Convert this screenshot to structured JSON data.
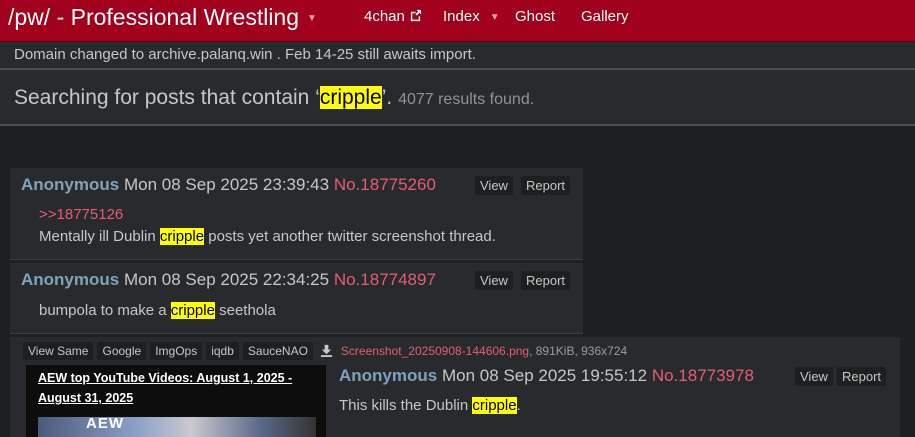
{
  "navbar": {
    "brand": "/pw/ - Professional Wrestling",
    "items": [
      "4chan",
      "Index",
      "Ghost",
      "Gallery"
    ]
  },
  "notice": "Domain changed to archive.palanq.win . Feb 14-25 still awaits import.",
  "search": {
    "prefix": "Searching for posts that contain ‘",
    "term": "cripple",
    "suffix": "’.",
    "results": "4077 results found."
  },
  "posts": [
    {
      "name": "Anonymous",
      "date": "Mon 08 Sep 2025 23:39:43",
      "number": "No.18775260",
      "view": "View",
      "report": "Report",
      "quote": ">>18775126",
      "text_before": "Mentally ill Dublin ",
      "highlight": "cripple",
      "text_after": " posts yet another twitter screenshot thread."
    },
    {
      "name": "Anonymous",
      "date": "Mon 08 Sep 2025 22:34:25",
      "number": "No.18774897",
      "view": "View",
      "report": "Report",
      "text_before": "bumpola to make a ",
      "highlight": "cripple",
      "text_after": " seethola"
    },
    {
      "name": "Anonymous",
      "date": "Mon 08 Sep 2025 19:55:12",
      "number": "No.18773978",
      "view": "View",
      "report": "Report",
      "text_before": "This kills the Dublin ",
      "highlight": "cripple",
      "text_after": ".",
      "file_tools": [
        "View Same",
        "Google",
        "ImgOps",
        "iqdb",
        "SauceNAO"
      ],
      "file_name": "Screenshot_20250908-144606.png",
      "file_meta": ", 891KiB, 936x724",
      "thumb_title": "AEW top YouTube Videos: August 1, 2025 - August 31, 2025",
      "thumb_logo": "AEW"
    }
  ],
  "colors": {
    "navbar": "#a0001c",
    "background": "#1d1f21",
    "post": "#282a2e",
    "name": "#81a2be",
    "post_number": "#e55e71",
    "highlight": "#ffff00"
  }
}
